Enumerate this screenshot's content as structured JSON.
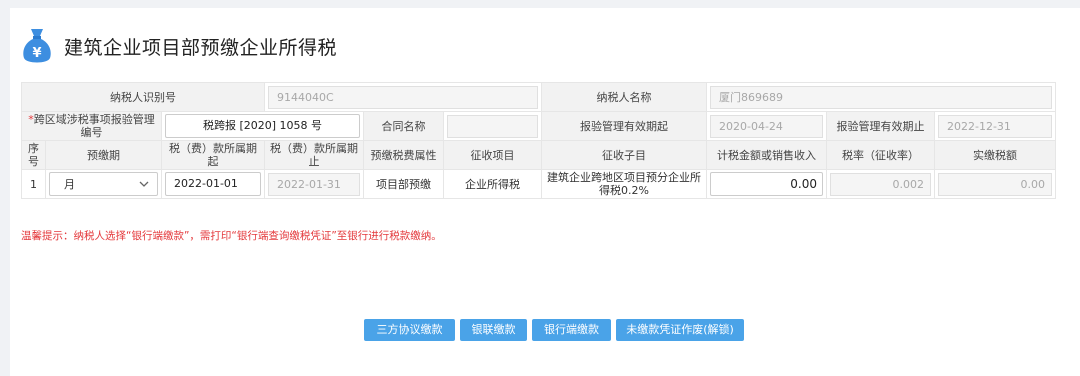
{
  "header": {
    "title": "建筑企业项目部预缴企业所得税",
    "icon": "money-bag-icon",
    "icon_glyph": "¥"
  },
  "info": {
    "taxpayer_id_label": "纳税人识别号",
    "taxpayer_id_value": "9144040C",
    "taxpayer_name_label": "纳税人名称",
    "taxpayer_name_value": "厦门869689",
    "cert_no_label": "跨区域涉税事项报验管理编号",
    "required_mark": "*",
    "cert_no_value": "税跨报 [2020] 1058 号",
    "contract_label": "合同名称",
    "contract_value": "",
    "valid_from_label": "报验管理有效期起",
    "valid_from_value": "2020-04-24",
    "valid_to_label": "报验管理有效期止",
    "valid_to_value": "2022-12-31"
  },
  "columns": [
    "序号",
    "预缴期",
    "税（费）款所属期起",
    "税（费）款所属期止",
    "预缴税费属性",
    "征收项目",
    "征收子目",
    "计税金额或销售收入",
    "税率（征收率）",
    "实缴税额"
  ],
  "row": {
    "seq": "1",
    "period": "月",
    "start": "2022-01-01",
    "end": "2022-01-31",
    "attr": "项目部预缴",
    "item": "企业所得税",
    "subitem": "建筑企业跨地区项目预分企业所得税0.2%",
    "amount": "0.00",
    "rate": "0.002",
    "tax": "0.00"
  },
  "tip": "温馨提示：纳税人选择“银行端缴款”，需打印“银行端查询缴税凭证”至银行进行税款缴纳。",
  "buttons": {
    "tripartite": "三方协议缴款",
    "unionpay": "银联缴款",
    "bank": "银行端缴款",
    "void": "未缴款凭证作废(解锁)"
  },
  "colors": {
    "accent": "#4aa3e8",
    "warn": "#e4393c",
    "bag": "#3d8ee0"
  }
}
